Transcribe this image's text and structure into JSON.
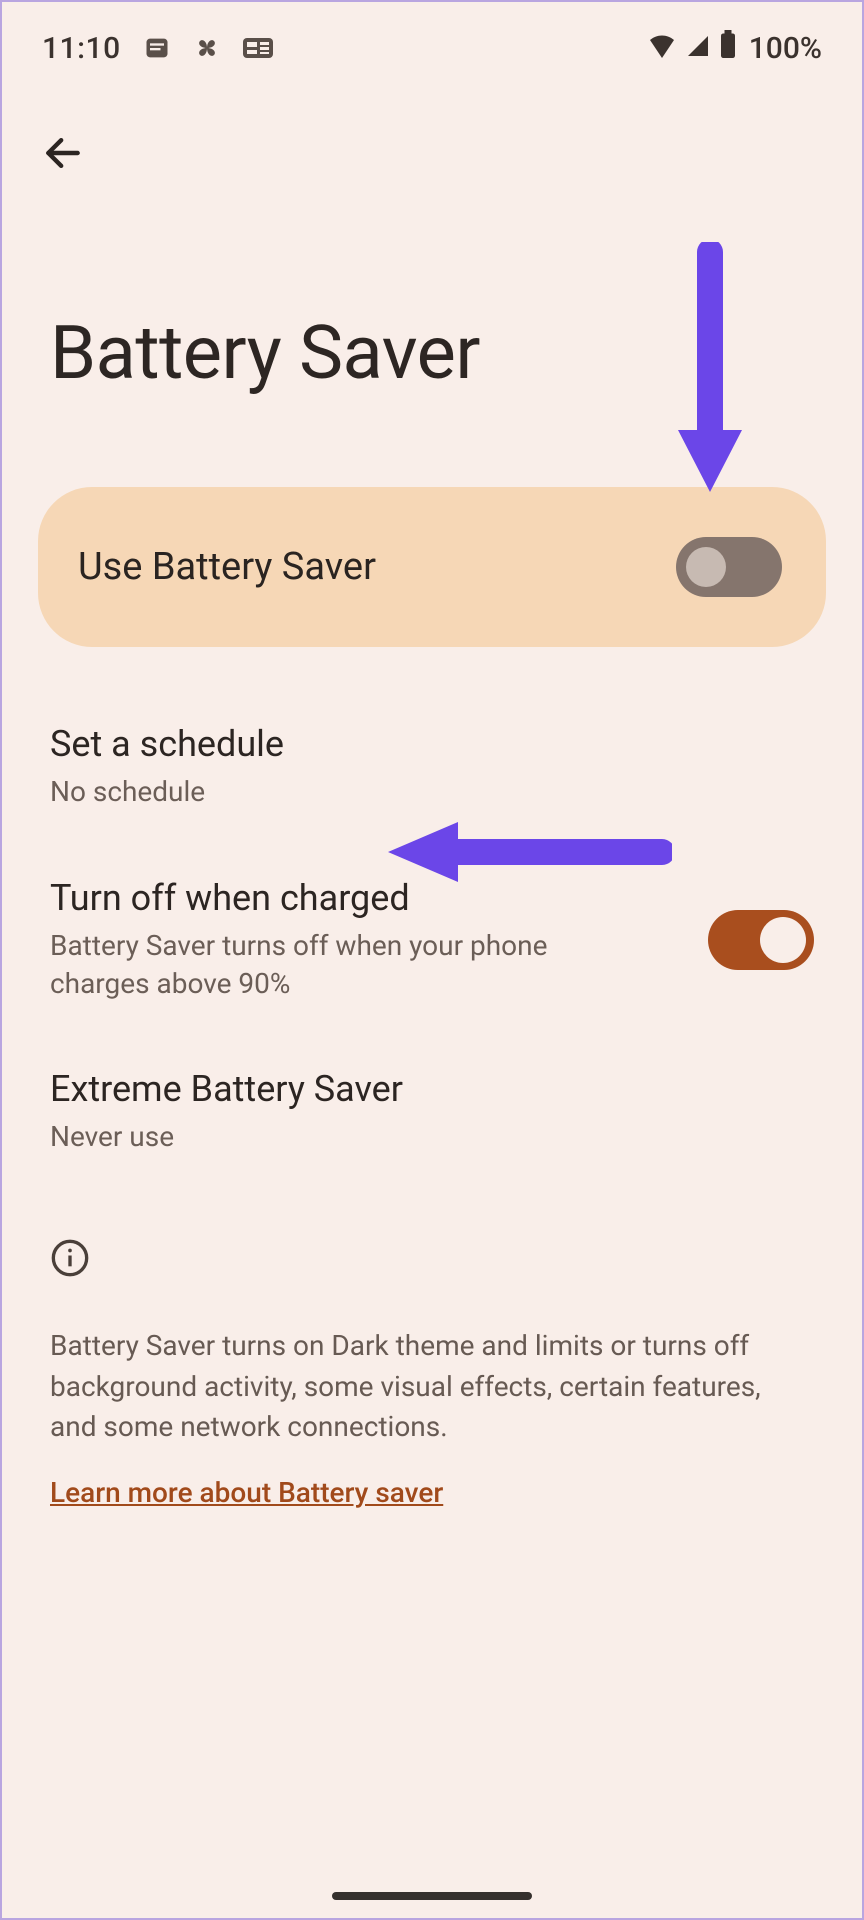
{
  "status": {
    "time": "11:10",
    "battery_pct": "100%"
  },
  "page": {
    "title": "Battery Saver"
  },
  "main_toggle": {
    "label": "Use Battery Saver",
    "state": "off"
  },
  "settings": {
    "schedule": {
      "title": "Set a schedule",
      "subtitle": "No schedule"
    },
    "turn_off_charged": {
      "title": "Turn off when charged",
      "subtitle": "Battery Saver turns off when your phone charges above 90%",
      "state": "on"
    },
    "extreme": {
      "title": "Extreme Battery Saver",
      "subtitle": "Never use"
    }
  },
  "info": {
    "text": "Battery Saver turns on Dark theme and limits or turns off background activity, some visual effects, certain features, and some network connections.",
    "learn_more": "Learn more about Battery saver"
  },
  "annotations": {
    "arrow1_target": "use-battery-saver-toggle",
    "arrow2_target": "set-a-schedule",
    "color": "#6b46e8"
  }
}
